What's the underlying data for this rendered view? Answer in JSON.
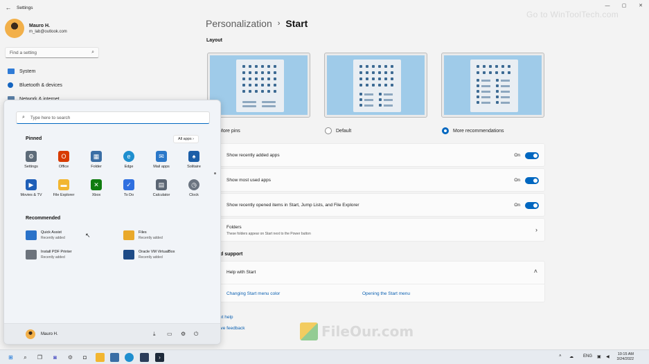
{
  "window": {
    "back_glyph": "←",
    "title": "Settings",
    "controls": [
      "—",
      "▢",
      "✕"
    ],
    "watermark": "Go to WinToolTech.com"
  },
  "profile": {
    "name": "Mauro H.",
    "email": "m_lab@outlook.com"
  },
  "search": {
    "placeholder": "Find a setting",
    "icon": "search-icon"
  },
  "nav": [
    {
      "label": "System",
      "icon": "monitor-icon",
      "color": "#2f7bd6"
    },
    {
      "label": "Bluetooth & devices",
      "icon": "bluetooth-icon",
      "color": "#1565c0"
    },
    {
      "label": "Network & internet",
      "icon": "network-icon",
      "color": "#5a7fa6"
    }
  ],
  "breadcrumb": {
    "parent": "Personalization",
    "separator": "›",
    "current": "Start"
  },
  "layout": {
    "heading": "Layout",
    "options": [
      {
        "label": "More pins",
        "selected": false
      },
      {
        "label": "Default",
        "selected": false
      },
      {
        "label": "More recommendations",
        "selected": true
      }
    ]
  },
  "settings": [
    {
      "label": "Show recently added apps",
      "state": "On"
    },
    {
      "label": "Show most used apps",
      "state": "On"
    },
    {
      "label": "Show recently opened items in Start, Jump Lists, and File Explorer",
      "state": "On"
    }
  ],
  "folders": {
    "label": "Folders",
    "description": "These folders appear on Start next to the Power button"
  },
  "support": {
    "heading": "d support",
    "help_label": "Help with Start",
    "links": [
      "Changing Start menu color",
      "Opening the Start menu"
    ]
  },
  "bottom_links": [
    "et help",
    "ive feedback"
  ],
  "start_menu": {
    "search_placeholder": "Type here to search",
    "pinned_heading": "Pinned",
    "all_apps": "All apps  ›",
    "pinned": [
      {
        "label": "Settings",
        "icon": "gear-icon",
        "color": "#5d6b79",
        "glyph": "⚙"
      },
      {
        "label": "Office",
        "icon": "office-icon",
        "color": "#d83b01",
        "glyph": "O"
      },
      {
        "label": "Folder",
        "icon": "folder-icon",
        "color": "#3a6ea5",
        "glyph": "▦"
      },
      {
        "label": "Edge",
        "icon": "edge-icon",
        "color": "#1f8fcf",
        "glyph": "e"
      },
      {
        "label": "Mail apps",
        "icon": "mail-icon",
        "color": "#2b78c9",
        "glyph": "✉"
      },
      {
        "label": "Solitaire",
        "icon": "solitaire-icon",
        "color": "#1b5ea8",
        "glyph": "♠"
      },
      {
        "label": "Movies & TV",
        "icon": "movies-icon",
        "color": "#1f5fb8",
        "glyph": "▶"
      },
      {
        "label": "File Explorer",
        "icon": "file-explorer-icon",
        "color": "#f2b631",
        "glyph": "▬"
      },
      {
        "label": "Xbox",
        "icon": "xbox-icon",
        "color": "#107c10",
        "glyph": "✕"
      },
      {
        "label": "To Do",
        "icon": "todo-icon",
        "color": "#2f6fe0",
        "glyph": "✓"
      },
      {
        "label": "Calculator",
        "icon": "calculator-icon",
        "color": "#5b6573",
        "glyph": "▤"
      },
      {
        "label": "Clock",
        "icon": "clock-icon",
        "color": "#6b7480",
        "glyph": "◷"
      }
    ],
    "recommended_heading": "Recommended",
    "recommended": [
      {
        "title": "Quick Assist",
        "subtitle": "Recently added",
        "icon": "quick-assist-icon",
        "color": "#2a72c9"
      },
      {
        "title": "Files",
        "subtitle": "Recently added",
        "icon": "files-icon",
        "color": "#e9a92b"
      },
      {
        "title": "Install PDF Printer",
        "subtitle": "Recently added",
        "icon": "printer-icon",
        "color": "#6c737c"
      },
      {
        "title": "Oracle VM VirtualBox",
        "subtitle": "Recently added",
        "icon": "virtualbox-icon",
        "color": "#1e4b87"
      }
    ],
    "user": "Mauro H.",
    "footer_icons": [
      "download-icon",
      "folder-icon",
      "gear-icon",
      "power-icon"
    ]
  },
  "taskbar": {
    "lang": "ENG",
    "time": "10:15 AM",
    "date": "3/24/2022"
  },
  "fileour_watermark": "FileOur.com"
}
